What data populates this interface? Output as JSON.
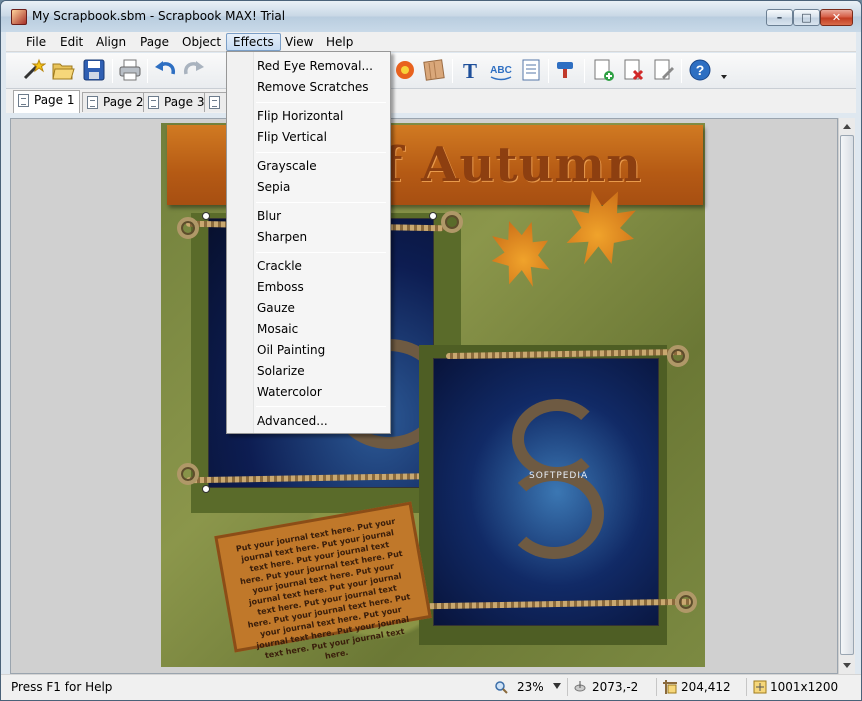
{
  "window": {
    "title": "My Scrapbook.sbm - Scrapbook MAX! Trial",
    "controls": {
      "minimize": "–",
      "maximize": "□",
      "close": "✕"
    }
  },
  "menubar": {
    "items": [
      {
        "label": "File"
      },
      {
        "label": "Edit"
      },
      {
        "label": "Align"
      },
      {
        "label": "Page"
      },
      {
        "label": "Object"
      },
      {
        "label": "Effects"
      },
      {
        "label": "View"
      },
      {
        "label": "Help"
      }
    ],
    "active": "Effects"
  },
  "toolbar": {
    "icons": [
      "magic-wand-icon",
      "open-folder-icon",
      "save-disk-icon",
      "print-icon",
      "undo-icon",
      "redo-icon",
      "flower-embellishment-icon",
      "paper-background-icon",
      "text-icon",
      "word-art-icon",
      "journal-icon",
      "stamp-icon",
      "add-page-icon",
      "delete-page-icon",
      "page-properties-icon",
      "help-icon"
    ]
  },
  "tabs": [
    {
      "label": "Page 1",
      "active": true
    },
    {
      "label": "Page 2",
      "active": false
    },
    {
      "label": "Page 3",
      "active": false
    },
    {
      "label": "",
      "active": false
    }
  ],
  "effects_menu": {
    "groups": [
      [
        "Red Eye Removal...",
        "Remove Scratches"
      ],
      [
        "Flip Horizontal",
        "Flip Vertical"
      ],
      [
        "Grayscale",
        "Sepia"
      ],
      [
        "Blur",
        "Sharpen"
      ],
      [
        "Crackle",
        "Emboss",
        "Gauze",
        "Mosaic",
        "Oil Painting",
        "Solarize",
        "Watercolor"
      ],
      [
        "Advanced..."
      ]
    ]
  },
  "canvas": {
    "banner_title": "Fall of Autumn",
    "journal_text": "Put your journal text here. Put your journal text here. Put your journal text here. Put your journal text here. Put your journal text here. Put your journal text here. Put your journal text here. Put your journal text here. Put your journal text here. Put your journal text here. Put your journal text here. Put your journal text here. Put your journal text here. Put your journal text here.",
    "watermark": "SOFTPEDIA"
  },
  "statusbar": {
    "help": "Press F1 for Help",
    "zoom": "23%",
    "cursor_pos": "2073,-2",
    "object_pos": "204,412",
    "page_size": "1001x1200"
  },
  "colors": {
    "menu_highlight": "#c6dbf2",
    "banner": "#b55a14",
    "background_green": "#7c8a42"
  }
}
